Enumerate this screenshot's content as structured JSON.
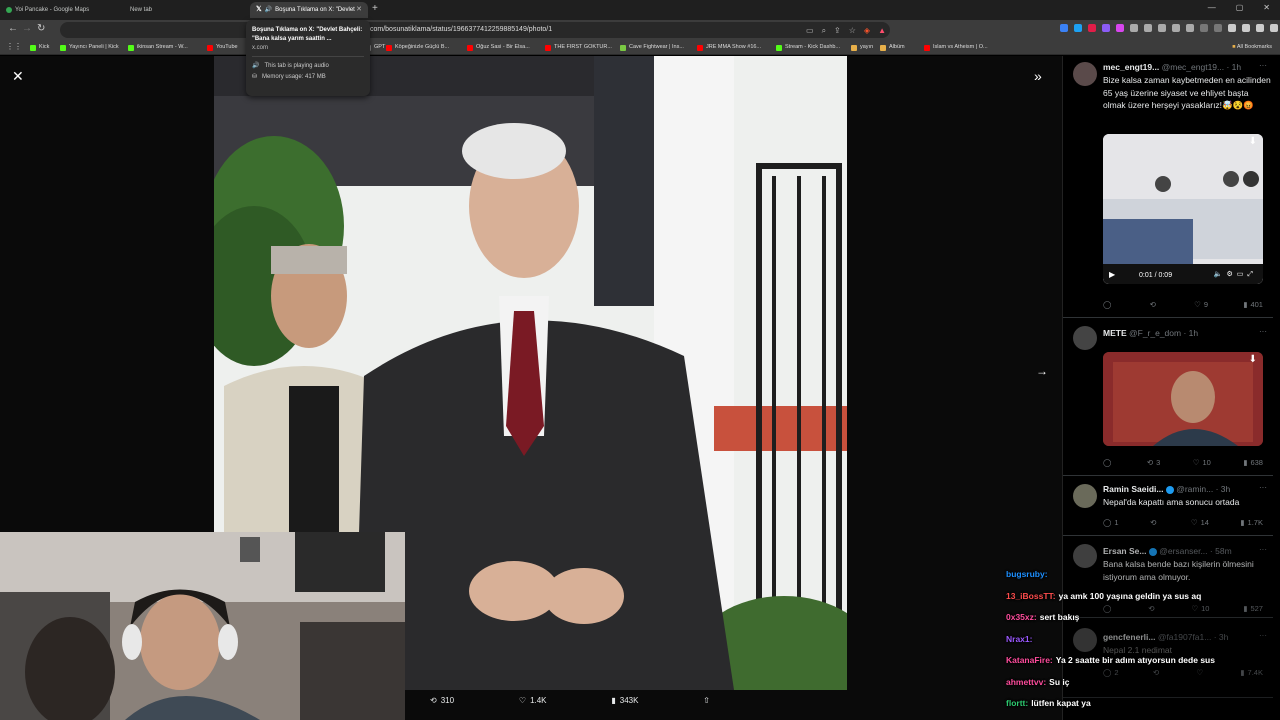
{
  "browser": {
    "tabs": [
      {
        "label": "Yoi Pancake - Google Maps",
        "active": false,
        "favicon_color": "#34a853"
      },
      {
        "label": "New tab",
        "active": false,
        "favicon_color": ""
      },
      {
        "label": "Boşuna Tıklama on X: \"Devlet",
        "active": true,
        "favicon_color": "#ffffff"
      }
    ],
    "url": "com/bosunatiklama/status/1966377412259885149/photo/1",
    "bookmarks": [
      {
        "label": "Kick",
        "color": "#53fc18"
      },
      {
        "label": "Yayıncı Paneli | Kick",
        "color": "#53fc18"
      },
      {
        "label": "ikinsan Stream - W...",
        "color": "#53fc18"
      },
      {
        "label": "YouTube",
        "color": "#ff0000"
      },
      {
        "label": "GPT",
        "color": "#888888"
      },
      {
        "label": "Köpeğinizle Güçlü B...",
        "color": "#ff0000"
      },
      {
        "label": "Oğuz Sasi - Bir Elsa...",
        "color": "#ff0000"
      },
      {
        "label": "THE FIRST GOKTUR...",
        "color": "#ff0000"
      },
      {
        "label": "Cave Fightwear | Ins...",
        "color": "#7ac943"
      },
      {
        "label": "JRE MMA Show #16...",
        "color": "#ff0000"
      },
      {
        "label": "Stream - Kick Dashb...",
        "color": "#53fc18"
      },
      {
        "label": "yayın",
        "color": "#e8b04a"
      },
      {
        "label": "Albüm",
        "color": "#e8b04a"
      },
      {
        "label": "Islam vs Atheism | O...",
        "color": "#ff0000"
      }
    ],
    "all_bookmarks": "All Bookmarks"
  },
  "tooltip": {
    "title": "Boşuna Tıklama on X: \"Devlet Bahçeli: \"Bana kalsa yarım saattin ...",
    "domain": "x.com",
    "audio": "This tab is playing audio",
    "memory": "Memory usage: 417 MB"
  },
  "photo_actions": {
    "retweets": "310",
    "likes": "1.4K",
    "views": "343K"
  },
  "timeline": [
    {
      "name": "mec_engt19...",
      "handle": "@mec_engt19...",
      "time": "· 1h",
      "text": "Bize kalsa zaman kaybetmeden en acilinden 65 yaş üzerine siyaset ve ehliyet başta olmak üzere herşeyi yasaklarız!🤯😵😡",
      "video_time": "0:01 / 0:09",
      "replies": "",
      "retweets": "",
      "likes": "9",
      "views": "401"
    },
    {
      "name": "METE",
      "handle": "@F_r_e_dom",
      "time": "· 1h",
      "text": "",
      "replies": "",
      "retweets": "3",
      "likes": "10",
      "views": "638"
    },
    {
      "name": "Ramin Saeidi...",
      "handle": "@ramin...",
      "time": "· 3h",
      "text": "Nepal'da kapattı ama sonucu ortada",
      "replies": "1",
      "retweets": "",
      "likes": "14",
      "views": "1.7K"
    },
    {
      "name": "Ersan Se...",
      "handle": "@ersanser...",
      "time": "· 58m",
      "text": "Bana kalsa bende bazı kişilerin ölmesini istiyorum ama olmuyor.",
      "replies": "",
      "retweets": "",
      "likes": "10",
      "views": "527"
    },
    {
      "name": "gencfenerli...",
      "handle": "@fa1907fa1...",
      "time": "· 3h",
      "text": "Nepal 2.1 nedimat",
      "replies": "2",
      "retweets": "",
      "likes": "",
      "views": "7.4K"
    }
  ],
  "chat": [
    {
      "user": "bugsruby:",
      "color": "#1e90ff",
      "text": ""
    },
    {
      "user": "13_iBossTT:",
      "color": "#ff4d4d",
      "text": "ya amk 100 yaşına geldin ya sus aq"
    },
    {
      "user": "0x35xz:",
      "color": "#ff4d9d",
      "text": "sert bakış"
    },
    {
      "user": "Nrax1:",
      "color": "#9b59ff",
      "text": ""
    },
    {
      "user": "KatanaFire:",
      "color": "#ff4d9d",
      "text": "Ya 2 saatte bir adım atıyorsun dede sus"
    },
    {
      "user": "ahmettvv:",
      "color": "#ff4d9d",
      "text": "Su iç"
    },
    {
      "user": "flortt:",
      "color": "#2ecc71",
      "text": "lütfen kapat ya"
    }
  ]
}
